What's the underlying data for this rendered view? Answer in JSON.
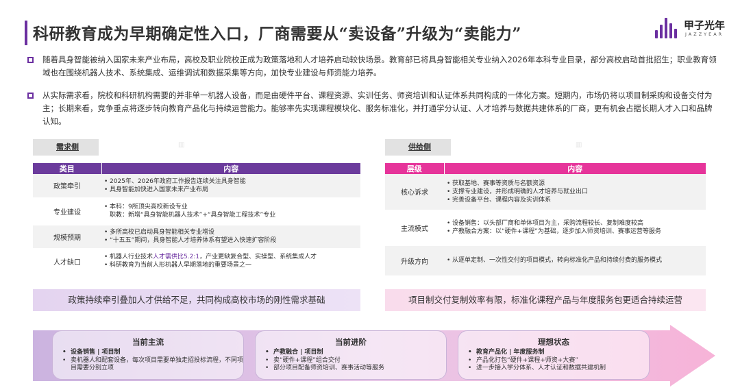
{
  "title": "科研教育成为早期确定性入口，厂商需要从“卖设备”升级为“卖能力”",
  "brand": {
    "name": "甲子光年",
    "sub": "JAZZYEAR",
    "color": "#6b2fa0"
  },
  "bullets": [
    "随着具身智能被纳入国家未来产业布局，高校及职业院校正成为政策落地和人才培养启动较快场景。教育部已将具身智能相关专业纳入2026年本科专业目录，部分高校启动首批招生；职业教育领域也在围绕机器人技术、系统集成、运维调试和数据采集等方向，加快专业建设与师资能力培养。",
    "从实际需求看，院校和科研机构需要的并非单一机器人设备，而是由硬件平台、课程资源、实训任务、师资培训和认证体系共同构成的一体化方案。短期内，市场仍将以项目制采购和设备交付为主；长期来看，竞争重点将逐步转向教育产品化与持续运营能力。能够率先实现课程模块化、服务标准化，并打通学分认证、人才培养与数据共建体系的厂商，更有机会占据长期人才入口和品牌认知。"
  ],
  "demand": {
    "tag": "需求侧",
    "headers": [
      "类目",
      "内容"
    ],
    "rows": [
      {
        "label": "政策牵引",
        "items": [
          "2025年、2026年政府工作报告连续关注具身智能",
          "具身智能加快进入国家未来产业布局"
        ]
      },
      {
        "label": "专业建设",
        "items": [
          "本科：9所顶尖高校新设专业\n职教：新增“具身智能机器人技术”+“具身智能工程技术”专业"
        ]
      },
      {
        "label": "规模预期",
        "items": [
          "多所高校已启动具身智能相关专业增设",
          "“十五五”期间，具身智能人才培养体系有望进入快速扩容阶段"
        ]
      },
      {
        "label": "人才缺口",
        "items": [
          "科研教育为当前人形机器人早期落地的重要场景之一"
        ],
        "first_prefix": "机器人行业技术",
        "first_em": "人才需供比5.2:1",
        "first_suffix": "，产业更缺复合型、实操型、系统集成人才"
      }
    ],
    "summary": "政策持续牵引叠加人才供给不足，共同构成高校市场的刚性需求基础",
    "colors": {
      "header": "#6b3b9c",
      "summary": "#e4d4f0"
    }
  },
  "supply": {
    "tag": "供给侧",
    "headers": [
      "层级",
      "内容"
    ],
    "rows": [
      {
        "label": "核心诉求",
        "items": [
          "获取基地、赛事等资质与名额资源",
          "支撑专业建设，并形成明确的人才培养与就业出口",
          "完善设备平台、课程内容及实训体系"
        ]
      },
      {
        "label": "主流模式",
        "items": [
          "设备销售：以头部厂商和单体项目为主，采购流程较长、复制难度较高",
          "产教融合方案：以“硬件+课程”为基础，逐步加入师资培训、赛事运营等服务"
        ]
      },
      {
        "label": "升级方向",
        "items": [
          "从逐单定制、一次性交付的项目模式，转向标准化产品和持续付费的服务模式"
        ]
      }
    ],
    "summary": "项目制交付复制效率有限，标准化课程产品与年度服务包更适合持续运营",
    "colors": {
      "header": "#e6349a",
      "summary": "#f9dcec"
    }
  },
  "stages": [
    {
      "title": "当前主流",
      "items": [
        {
          "text": "设备销售 | 项目制",
          "bold": true
        },
        {
          "text": "卖机器人和配套设备，每次项目需要单独走招投标流程，不同项目需要分别立项",
          "bold": false
        }
      ]
    },
    {
      "title": "当前进阶",
      "items": [
        {
          "text": "产教融合 | 项目制",
          "bold": true
        },
        {
          "text": "卖“硬件+课程”组合交付",
          "bold": false
        },
        {
          "text": "部分项目配备师资培训、赛事活动等服务",
          "bold": false
        }
      ]
    },
    {
      "title": "理想状态",
      "items": [
        {
          "text": "教育产品化 | 年度服务制",
          "bold": true
        },
        {
          "text": "产品化打包“硬件+课程+师资+大赛”",
          "bold": false
        },
        {
          "text": "进一步接入学分体系、人才认证和数据共建机制",
          "bold": false
        }
      ]
    }
  ]
}
